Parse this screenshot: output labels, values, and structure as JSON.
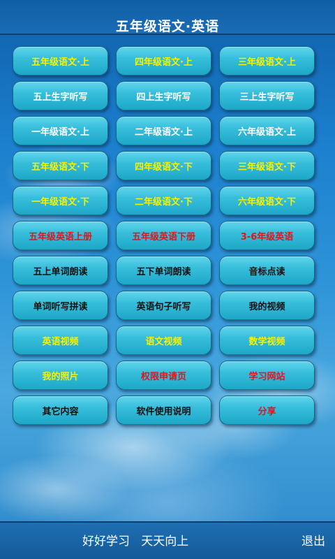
{
  "header": {
    "title": "五年级语文·英语"
  },
  "colors": {
    "yellow": "#f7f200",
    "white": "#ffffff",
    "black": "#111111",
    "red": "#e3141c",
    "button_top": "#62d5ec",
    "button_bottom": "#1fa7c8",
    "bar": "#145a98"
  },
  "menu": {
    "rows": [
      [
        {
          "label": "五年级语文·上",
          "color": "yellow"
        },
        {
          "label": "四年级语文·上",
          "color": "yellow"
        },
        {
          "label": "三年级语文·上",
          "color": "yellow"
        }
      ],
      [
        {
          "label": "五上生字听写",
          "color": "white"
        },
        {
          "label": "四上生字听写",
          "color": "white"
        },
        {
          "label": "三上生字听写",
          "color": "white"
        }
      ],
      [
        {
          "label": "一年级语文·上",
          "color": "white"
        },
        {
          "label": "二年级语文·上",
          "color": "white"
        },
        {
          "label": "六年级语文·上",
          "color": "white"
        }
      ],
      [
        {
          "label": "五年级语文·下",
          "color": "yellow"
        },
        {
          "label": "四年级语文·下",
          "color": "yellow"
        },
        {
          "label": "三年级语文·下",
          "color": "yellow"
        }
      ],
      [
        {
          "label": "一年级语文·下",
          "color": "yellow"
        },
        {
          "label": "二年级语文·下",
          "color": "yellow"
        },
        {
          "label": "六年级语文·下",
          "color": "yellow"
        }
      ],
      [
        {
          "label": "五年级英语上册",
          "color": "red"
        },
        {
          "label": "五年级英语下册",
          "color": "red"
        },
        {
          "label": "3-6年级英语",
          "color": "red"
        }
      ],
      [
        {
          "label": "五上单词朗读",
          "color": "black"
        },
        {
          "label": "五下单词朗读",
          "color": "black"
        },
        {
          "label": "音标点读",
          "color": "black"
        }
      ],
      [
        {
          "label": "单词听写拼读",
          "color": "black"
        },
        {
          "label": "英语句子听写",
          "color": "black"
        },
        {
          "label": "我的视频",
          "color": "black"
        }
      ],
      [
        {
          "label": "英语视频",
          "color": "yellow"
        },
        {
          "label": "语文视频",
          "color": "yellow"
        },
        {
          "label": "数学视频",
          "color": "yellow"
        }
      ],
      [
        {
          "label": "我的照片",
          "color": "yellow"
        },
        {
          "label": "权限申请页",
          "color": "red"
        },
        {
          "label": "学习网站",
          "color": "red"
        }
      ],
      [
        {
          "label": "其它内容",
          "color": "black"
        },
        {
          "label": "软件使用说明",
          "color": "black"
        },
        {
          "label": "分享",
          "color": "red"
        }
      ]
    ]
  },
  "footer": {
    "motto": "好好学习   天天向上",
    "exit_label": "退出"
  }
}
